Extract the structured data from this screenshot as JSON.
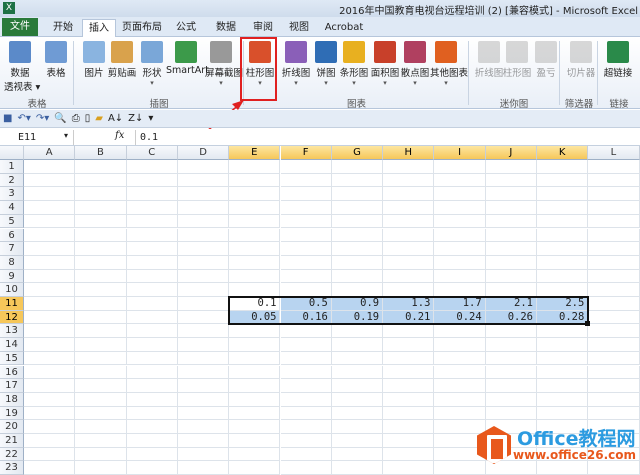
{
  "window": {
    "title": "2016年中国教育电视台远程培训 (2) [兼容模式] - Microsoft Excel",
    "app_icon": "X"
  },
  "tabs": [
    "文件",
    "开始",
    "插入",
    "页面布局",
    "公式",
    "数据",
    "审阅",
    "视图",
    "Acrobat"
  ],
  "active_tab": "插入",
  "ribbon": {
    "buttons": [
      {
        "id": "pivot",
        "label": "数据",
        "label2": "透视表 ▾",
        "color": "#5b8ac9"
      },
      {
        "id": "table",
        "label": "表格",
        "color": "#6f9bd4"
      },
      {
        "id": "picture",
        "label": "图片",
        "color": "#8ab4e0"
      },
      {
        "id": "clipart",
        "label": "剪贴画",
        "color": "#d9a24c"
      },
      {
        "id": "shapes",
        "label": "形状",
        "color": "#7aa7d8",
        "dd": true
      },
      {
        "id": "smartart",
        "label": "SmartArt",
        "color": "#3c9a4a"
      },
      {
        "id": "screenshot",
        "label": "屏幕截图",
        "color": "#999",
        "dd": true
      },
      {
        "id": "column-chart",
        "label": "柱形图",
        "color": "#d9502b",
        "dd": true
      },
      {
        "id": "line-chart",
        "label": "折线图",
        "color": "#8a5fb8",
        "dd": true
      },
      {
        "id": "pie-chart",
        "label": "饼图",
        "color": "#2f6db5",
        "dd": true
      },
      {
        "id": "bar-chart",
        "label": "条形图",
        "color": "#e8b020",
        "dd": true
      },
      {
        "id": "area-chart",
        "label": "面积图",
        "color": "#c8402a",
        "dd": true
      },
      {
        "id": "scatter-chart",
        "label": "散点图",
        "color": "#b04060",
        "dd": true
      },
      {
        "id": "other-charts",
        "label": "其他图表",
        "color": "#e06020",
        "dd": true
      },
      {
        "id": "spark-line",
        "label": "折线图",
        "color": "#aaa"
      },
      {
        "id": "spark-column",
        "label": "柱形图",
        "color": "#aaa"
      },
      {
        "id": "spark-winloss",
        "label": "盈亏",
        "color": "#aaa"
      },
      {
        "id": "slicer",
        "label": "切片器",
        "color": "#aaa"
      },
      {
        "id": "hyperlink",
        "label": "超链接",
        "color": "#2a8a4a"
      }
    ],
    "groups": [
      "表格",
      "插图",
      "图表",
      "迷你图",
      "筛选器",
      "链接"
    ]
  },
  "formula_bar": {
    "name_box": "E11",
    "fx": "fx",
    "value": "0.1"
  },
  "columns": [
    "A",
    "B",
    "C",
    "D",
    "E",
    "F",
    "G",
    "H",
    "I",
    "J",
    "K",
    "L"
  ],
  "rows": [
    "1",
    "2",
    "3",
    "4",
    "5",
    "6",
    "7",
    "8",
    "9",
    "10",
    "11",
    "12",
    "13",
    "14",
    "15",
    "16",
    "17",
    "18",
    "19",
    "20",
    "21",
    "22",
    "23"
  ],
  "cells": {
    "row11": [
      "0.1",
      "0.5",
      "0.9",
      "1.3",
      "1.7",
      "2.1",
      "2.5"
    ],
    "row12": [
      "0.05",
      "0.16",
      "0.19",
      "0.21",
      "0.24",
      "0.26",
      "0.28"
    ]
  },
  "selection": "E11:K12",
  "watermark": {
    "line1": "Office教程网",
    "line2": "www.office26.com"
  },
  "colors": {
    "accent_red": "#e02020",
    "selection": "#b8d4f0",
    "file_tab": "#2a7a3a"
  }
}
